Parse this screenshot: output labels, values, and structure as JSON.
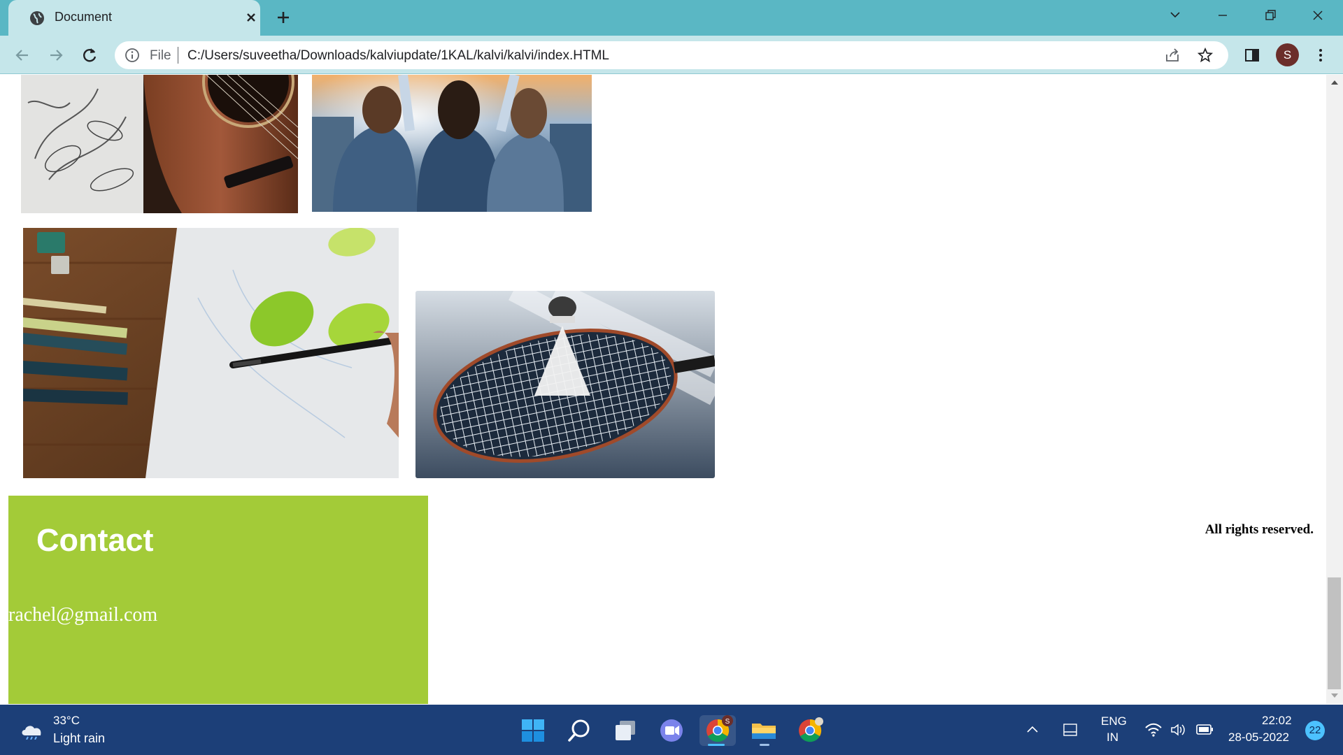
{
  "browser": {
    "tab_title": "Document",
    "address_scheme": "File",
    "address_url": "C:/Users/suveetha/Downloads/kalviupdate/1KAL/kalvi/kalvi/index.HTML",
    "profile_initial": "S"
  },
  "page": {
    "gallery": [
      {
        "name": "guitar-photo",
        "icon": "guitar"
      },
      {
        "name": "friends-sunset-photo",
        "icon": "people"
      },
      {
        "name": "painting-leaves-photo",
        "icon": "paintbrush"
      },
      {
        "name": "badminton-photo",
        "icon": "shuttlecock"
      }
    ],
    "contact": {
      "title": "Contact",
      "email": "rachel@gmail.com",
      "bg_color": "#a3cb38"
    },
    "footer_text": "All rights reserved."
  },
  "taskbar": {
    "weather_temp": "33°C",
    "weather_desc": "Light rain",
    "lang_line1": "ENG",
    "lang_line2": "IN",
    "time": "22:02",
    "date": "28-05-2022",
    "notification_count": "22",
    "apps": [
      "windows-start",
      "search",
      "task-view",
      "teams-chat",
      "chrome",
      "file-explorer",
      "chrome-profile"
    ]
  }
}
